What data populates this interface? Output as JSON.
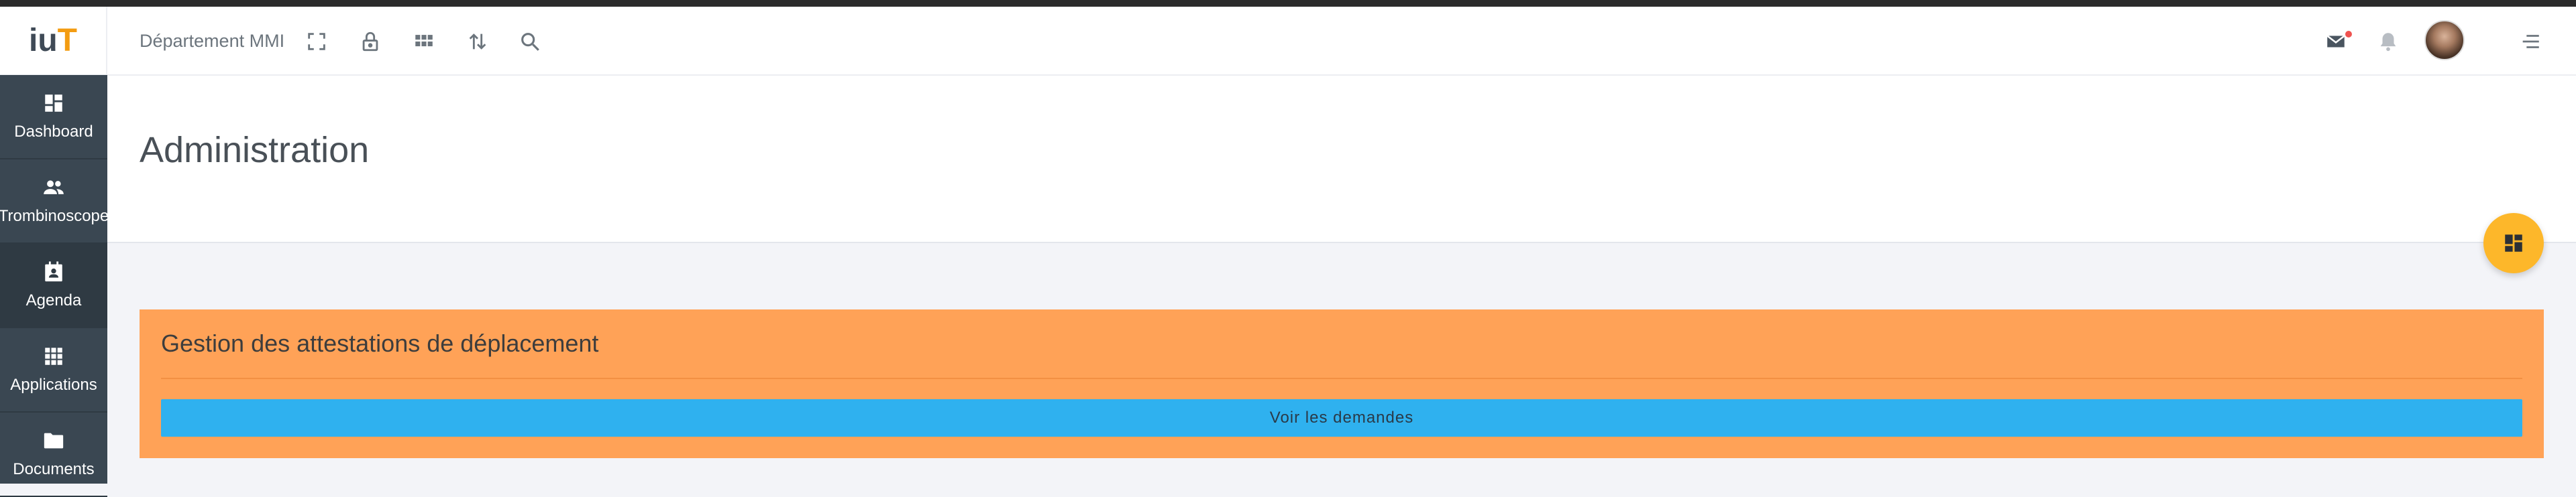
{
  "header": {
    "logo_part1": "iu",
    "logo_part2": "T",
    "department": "Département MMI",
    "icons": [
      "fullscreen-icon",
      "lock-icon",
      "apps-grid-icon",
      "swap-vertical-icon",
      "search-icon",
      "mail-icon",
      "bell-icon",
      "avatar",
      "menu-icon"
    ],
    "notification_dot_color": "#ef5350"
  },
  "sidebar": {
    "items": [
      {
        "label": "Dashboard",
        "icon": "dashboard-icon"
      },
      {
        "label": "Trombinoscope",
        "icon": "people-icon"
      },
      {
        "label": "Agenda",
        "icon": "calendar-contact-icon"
      },
      {
        "label": "Applications",
        "icon": "apps-grid-icon"
      },
      {
        "label": "Documents",
        "icon": "folder-icon"
      }
    ]
  },
  "page": {
    "title": "Administration"
  },
  "card": {
    "title": "Gestion des attestations de déplacement",
    "button_label": "Voir les demandes",
    "background_color": "#ffa257",
    "button_color": "#2fb1ef"
  },
  "fab": {
    "icon": "dashboard-icon",
    "color": "#fdb72a"
  },
  "colors": {
    "sidebar": "#3a4752",
    "accent": "#f39c12"
  }
}
